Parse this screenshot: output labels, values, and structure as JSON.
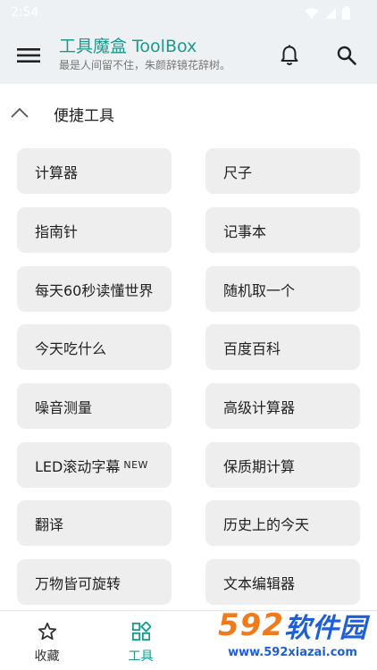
{
  "status_bar": {
    "time": "2:54"
  },
  "app_bar": {
    "title": "工具魔盒 ToolBox",
    "subtitle": "最是人间留不住，朱颜辞镜花辞树。"
  },
  "section": {
    "title": "便捷工具"
  },
  "tools": [
    {
      "label": "计算器"
    },
    {
      "label": "尺子"
    },
    {
      "label": "指南针"
    },
    {
      "label": "记事本"
    },
    {
      "label": "每天60秒读懂世界"
    },
    {
      "label": "随机取一个"
    },
    {
      "label": "今天吃什么"
    },
    {
      "label": "百度百科"
    },
    {
      "label": "噪音测量"
    },
    {
      "label": "高级计算器"
    },
    {
      "label": "LED滚动字幕",
      "tag": "NEW"
    },
    {
      "label": "保质期计算"
    },
    {
      "label": "翻译"
    },
    {
      "label": "历史上的今天"
    },
    {
      "label": "万物皆可旋转"
    },
    {
      "label": "文本编辑器"
    }
  ],
  "bottom_nav": [
    {
      "label": "收藏",
      "icon": "star-outline-icon",
      "active": false
    },
    {
      "label": "工具",
      "icon": "apps-grid-icon",
      "active": true
    }
  ],
  "watermark": {
    "logo_number": "592",
    "logo_text": "软件园",
    "url": "www.592xiazai.com"
  },
  "colors": {
    "accent": "#1a9a8a",
    "button_bg": "#eeeeee",
    "app_bar_bg": "#eef1f3"
  }
}
